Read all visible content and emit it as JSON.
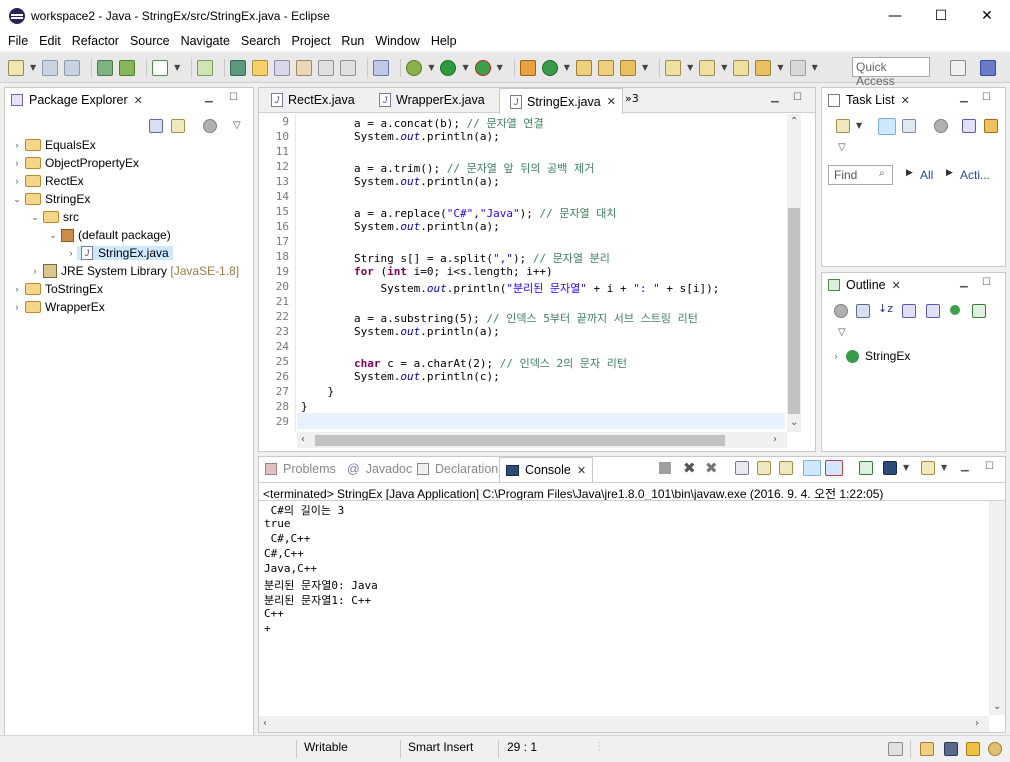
{
  "window": {
    "title": "workspace2 - Java - StringEx/src/StringEx.java - Eclipse",
    "minimize": "—",
    "maximize": "☐",
    "close": "✕"
  },
  "menu": [
    "File",
    "Edit",
    "Refactor",
    "Source",
    "Navigate",
    "Search",
    "Project",
    "Run",
    "Window",
    "Help"
  ],
  "toolbar": {
    "quick_access": "Quick Access"
  },
  "package_explorer": {
    "title": "Package Explorer",
    "items": [
      {
        "label": "EqualsEx",
        "expanded": false
      },
      {
        "label": "ObjectPropertyEx",
        "expanded": false
      },
      {
        "label": "RectEx",
        "expanded": false
      },
      {
        "label": "StringEx",
        "expanded": true
      },
      {
        "label": "src",
        "expanded": true
      },
      {
        "label": "(default package)",
        "expanded": true
      },
      {
        "label": "StringEx.java",
        "selected": true
      },
      {
        "label": "JRE System Library",
        "suffix": "[JavaSE-1.8]"
      },
      {
        "label": "ToStringEx",
        "expanded": false
      },
      {
        "label": "WrapperEx",
        "expanded": false
      }
    ]
  },
  "editor": {
    "tabs": [
      {
        "label": "RectEx.java",
        "active": false
      },
      {
        "label": "WrapperEx.java",
        "active": false
      },
      {
        "label": "StringEx.java",
        "active": true
      }
    ],
    "overflow": "»3",
    "lines": [
      {
        "n": "9"
      },
      {
        "n": "10"
      },
      {
        "n": "11"
      },
      {
        "n": "12"
      },
      {
        "n": "13"
      },
      {
        "n": "14"
      },
      {
        "n": "15"
      },
      {
        "n": "16"
      },
      {
        "n": "17"
      },
      {
        "n": "18"
      },
      {
        "n": "19"
      },
      {
        "n": "20"
      },
      {
        "n": "21"
      },
      {
        "n": "22"
      },
      {
        "n": "23"
      },
      {
        "n": "24"
      },
      {
        "n": "25"
      },
      {
        "n": "26"
      },
      {
        "n": "27"
      },
      {
        "n": "28"
      },
      {
        "n": "29"
      }
    ],
    "code": {
      "l9a": "        a = a.concat(b); ",
      "l9c": "// 문자열 연결",
      "l10a": "        System.",
      "l10f": "out",
      "l10b": ".println(a);",
      "l12a": "        a = a.trim(); ",
      "l12c": "// 문자열 앞 뒤의 공백 제거",
      "l13a": "        System.",
      "l13f": "out",
      "l13b": ".println(a);",
      "l15a": "        a = a.replace(",
      "l15s1": "\"C#\"",
      "l15m": ",",
      "l15s2": "\"Java\"",
      "l15b": "); ",
      "l15c": "// 문자열 대치",
      "l16a": "        System.",
      "l16f": "out",
      "l16b": ".println(a);",
      "l18a": "        String s[] = a.split(",
      "l18s": "\",\"",
      "l18b": "); ",
      "l18c": "// 문자열 분리",
      "l19i": "        ",
      "l19k1": "for",
      "l19a": " (",
      "l19k2": "int",
      "l19b": " i=0; i<s.length; i++)",
      "l20a": "            System.",
      "l20f": "out",
      "l20b": ".println(",
      "l20s1": "\"분리된 문자열\"",
      "l20m": " + i + ",
      "l20s2": "\": \"",
      "l20e": " + s[i]);",
      "l22a": "        a = a.substring(5); ",
      "l22c": "// 인덱스 5부터 끝까지 서브 스트링 리턴",
      "l23a": "        System.",
      "l23f": "out",
      "l23b": ".println(a);",
      "l25i": "        ",
      "l25k": "char",
      "l25a": " c = a.charAt(2); ",
      "l25c": "// 인덱스 2의 문자 리턴",
      "l26a": "        System.",
      "l26f": "out",
      "l26b": ".println(c);",
      "l27": "    }",
      "l28": "}"
    }
  },
  "task_list": {
    "title": "Task List",
    "find_placeholder": "Find",
    "all": "All",
    "activate": "Acti..."
  },
  "outline": {
    "title": "Outline",
    "item": "StringEx"
  },
  "bottom_tabs": [
    {
      "label": "Problems",
      "active": false
    },
    {
      "label": "Javadoc",
      "active": false
    },
    {
      "label": "Declaration",
      "active": false
    },
    {
      "label": "Console",
      "active": true
    }
  ],
  "console": {
    "header": "<terminated> StringEx [Java Application] C:\\Program Files\\Java\\jre1.8.0_101\\bin\\javaw.exe (2016. 9. 4. 오전 1:22:05)",
    "lines": [
      " C#의 길이는 3",
      "true",
      " C#,C++",
      "C#,C++",
      "Java,C++",
      "분리된 문자열0: Java",
      "분리된 문자열1: C++",
      "C++",
      "+"
    ]
  },
  "status": {
    "writable": "Writable",
    "insert_mode": "Smart Insert",
    "position": "29 : 1"
  },
  "colors": {
    "keyword": "#7f0055",
    "string": "#2a00ff",
    "comment": "#3f7f5f",
    "field": "#0000c0",
    "selection": "#cde8ff"
  }
}
